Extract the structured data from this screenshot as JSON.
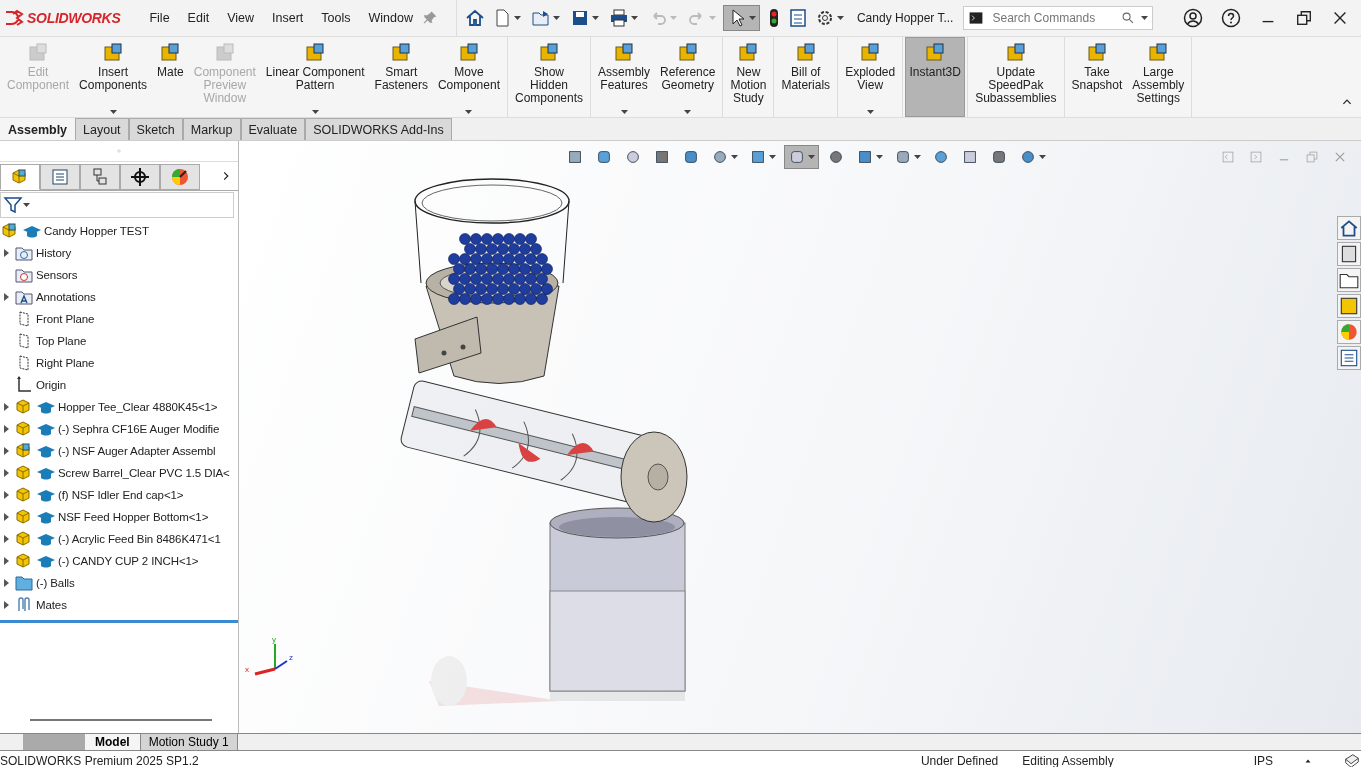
{
  "app": {
    "logo": "SOLIDWORKS"
  },
  "menu": [
    "File",
    "Edit",
    "View",
    "Insert",
    "Tools",
    "Window"
  ],
  "select_tool": {
    "selected": true
  },
  "document_title": "Candy Hopper T...",
  "search": {
    "placeholder": "Search Commands"
  },
  "ribbon": {
    "groups": [
      {
        "buttons": [
          {
            "label": "Edit\nComponent",
            "disabled": true,
            "dropdown": false,
            "selected": false
          },
          {
            "label": "Insert\nComponents",
            "disabled": false,
            "dropdown": true,
            "selected": false
          },
          {
            "label": "Mate",
            "disabled": false,
            "dropdown": false,
            "selected": false
          },
          {
            "label": "Component\nPreview\nWindow",
            "disabled": true,
            "dropdown": false,
            "selected": false
          },
          {
            "label": "Linear Component\nPattern",
            "disabled": false,
            "dropdown": true,
            "selected": false
          },
          {
            "label": "Smart\nFasteners",
            "disabled": false,
            "dropdown": false,
            "selected": false
          },
          {
            "label": "Move\nComponent",
            "disabled": false,
            "dropdown": true,
            "selected": false
          }
        ]
      },
      {
        "buttons": [
          {
            "label": "Show\nHidden\nComponents",
            "disabled": false,
            "dropdown": false,
            "selected": false
          }
        ]
      },
      {
        "buttons": [
          {
            "label": "Assembly\nFeatures",
            "disabled": false,
            "dropdown": true,
            "selected": false
          },
          {
            "label": "Reference\nGeometry",
            "disabled": false,
            "dropdown": true,
            "selected": false
          }
        ]
      },
      {
        "buttons": [
          {
            "label": "New\nMotion\nStudy",
            "disabled": false,
            "dropdown": false,
            "selected": false
          }
        ]
      },
      {
        "buttons": [
          {
            "label": "Bill of\nMaterials",
            "disabled": false,
            "dropdown": false,
            "selected": false
          }
        ]
      },
      {
        "buttons": [
          {
            "label": "Exploded\nView",
            "disabled": false,
            "dropdown": true,
            "selected": false
          }
        ]
      },
      {
        "buttons": [
          {
            "label": "Instant3D",
            "disabled": false,
            "dropdown": false,
            "selected": true
          }
        ]
      },
      {
        "buttons": [
          {
            "label": "Update\nSpeedPak\nSubassemblies",
            "disabled": false,
            "dropdown": false,
            "selected": false
          }
        ]
      },
      {
        "buttons": [
          {
            "label": "Take\nSnapshot",
            "disabled": false,
            "dropdown": false,
            "selected": false
          },
          {
            "label": "Large\nAssembly\nSettings",
            "disabled": false,
            "dropdown": false,
            "selected": false
          }
        ]
      }
    ]
  },
  "command_tabs": [
    {
      "label": "Assembly",
      "selected": true
    },
    {
      "label": "Layout",
      "selected": false
    },
    {
      "label": "Sketch",
      "selected": false
    },
    {
      "label": "Markup",
      "selected": false
    },
    {
      "label": "Evaluate",
      "selected": false
    },
    {
      "label": "SOLIDWORKS Add-Ins",
      "selected": false
    }
  ],
  "feature_manager": {
    "tabs": [
      {
        "selected": true
      },
      {
        "selected": false
      },
      {
        "selected": false
      },
      {
        "selected": false
      },
      {
        "selected": false
      }
    ],
    "root": {
      "label": "Candy Hopper TEST"
    },
    "items": [
      {
        "kind": "history",
        "label": "History",
        "expandable": true
      },
      {
        "kind": "sensors",
        "label": "Sensors",
        "expandable": false
      },
      {
        "kind": "annotations",
        "label": "Annotations",
        "expandable": true
      },
      {
        "kind": "plane",
        "label": "Front Plane",
        "expandable": false
      },
      {
        "kind": "plane",
        "label": "Top Plane",
        "expandable": false
      },
      {
        "kind": "plane",
        "label": "Right Plane",
        "expandable": false
      },
      {
        "kind": "origin",
        "label": "Origin",
        "expandable": false
      },
      {
        "kind": "part",
        "label": "Hopper Tee_Clear 4880K45<1>",
        "expandable": true
      },
      {
        "kind": "part",
        "label": "(-) Sephra CF16E Auger Modifie",
        "expandable": true
      },
      {
        "kind": "assembly",
        "label": "(-) NSF Auger Adapter Assembl",
        "expandable": true
      },
      {
        "kind": "part",
        "label": "Screw Barrel_Clear PVC 1.5 DIA<",
        "expandable": true
      },
      {
        "kind": "part",
        "label": "(f) NSF Idler End cap<1>",
        "expandable": true
      },
      {
        "kind": "part",
        "label": "NSF Feed Hopper Bottom<1>",
        "expandable": true
      },
      {
        "kind": "part",
        "label": "(-) Acrylic Feed Bin 8486K471<1",
        "expandable": true
      },
      {
        "kind": "part",
        "label": "(-) CANDY CUP 2 INCH<1>",
        "expandable": true
      },
      {
        "kind": "folder",
        "label": "(-) Balls",
        "expandable": true
      },
      {
        "kind": "mates",
        "label": "Mates",
        "expandable": true
      }
    ]
  },
  "triad": {
    "x": "x",
    "y": "y",
    "z": "z"
  },
  "bottom_tabs": [
    {
      "label": "Model",
      "selected": true
    },
    {
      "label": "Motion Study 1",
      "selected": false
    }
  ],
  "status_bar": {
    "product": "SOLIDWORKS Premium 2025 SP1.2",
    "fields": [
      "Under Defined",
      "Editing Assembly",
      "IPS"
    ]
  }
}
